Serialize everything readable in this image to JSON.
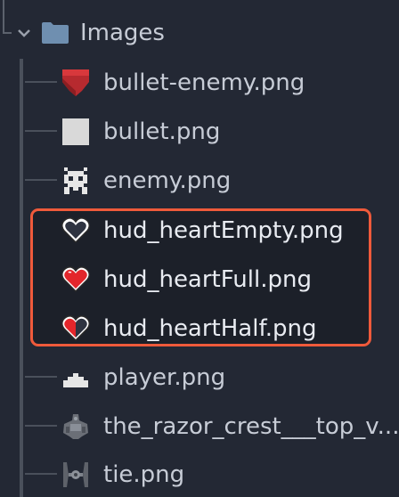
{
  "folder": {
    "label": "Images",
    "expanded": true
  },
  "files": [
    {
      "label": "bullet-enemy.png",
      "icon": "shield-icon",
      "highlighted": false
    },
    {
      "label": "bullet.png",
      "icon": "square-icon",
      "highlighted": false
    },
    {
      "label": "enemy.png",
      "icon": "alien-icon",
      "highlighted": false
    },
    {
      "label": "hud_heartEmpty.png",
      "icon": "heart-empty-icon",
      "highlighted": true
    },
    {
      "label": "hud_heartFull.png",
      "icon": "heart-full-icon",
      "highlighted": true
    },
    {
      "label": "hud_heartHalf.png",
      "icon": "heart-half-icon",
      "highlighted": true
    },
    {
      "label": "player.png",
      "icon": "ship-icon",
      "highlighted": false
    },
    {
      "label": "the_razor_crest___top_v...",
      "icon": "spaceship-icon",
      "highlighted": false
    },
    {
      "label": "tie.png",
      "icon": "tie-fighter-icon",
      "highlighted": false
    }
  ],
  "colors": {
    "background": "#232834",
    "highlight_border": "#ef5a3b",
    "folder": "#6f8fb0",
    "heart_red": "#e3262b"
  }
}
